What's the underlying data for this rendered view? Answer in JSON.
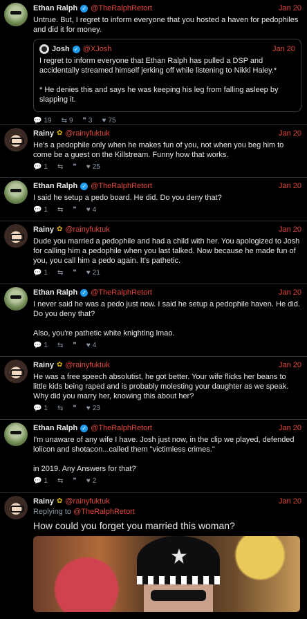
{
  "tweets": [
    {
      "name": "Ethan Ralph",
      "handle": "@TheRalphRetort",
      "date": "Jan 20",
      "text": "Untrue. But, I regret to inform everyone that you hosted a haven for pedophiles and did it for money.",
      "quote": {
        "name": "Josh",
        "handle": "@XJosh",
        "date": "Jan 20",
        "text": "I regret to inform everyone that Ethan Ralph has pulled a DSP and accidentally streamed himself jerking off while listening to Nikki Haley.*\n\n* He denies this and says he was keeping his leg from falling asleep by slapping it."
      },
      "stats": {
        "replies": "19",
        "retweets": "9",
        "quotes": "3",
        "likes": "75"
      }
    },
    {
      "name": "Rainy",
      "handle": "@rainyfuktuk",
      "date": "Jan 20",
      "text": "He's a pedophile only when he makes fun of you, not when you beg him to come be a guest on the Killstream. Funny how that works.",
      "stats": {
        "replies": "1",
        "retweets": "",
        "quotes": "",
        "likes": "25"
      }
    },
    {
      "name": "Ethan Ralph",
      "handle": "@TheRalphRetort",
      "date": "Jan 20",
      "text": "I said he setup a pedo board. He did. Do you deny that?",
      "stats": {
        "replies": "1",
        "retweets": "",
        "quotes": "",
        "likes": "4"
      }
    },
    {
      "name": "Rainy",
      "handle": "@rainyfuktuk",
      "date": "Jan 20",
      "text": "Dude you married a pedophile and had a child with her. You apologized to Josh for calling him a pedophile when you last talked. Now because he made fun of you, you call him a pedo again. It's pathetic.",
      "stats": {
        "replies": "1",
        "retweets": "",
        "quotes": "",
        "likes": "21"
      }
    },
    {
      "name": "Ethan Ralph",
      "handle": "@TheRalphRetort",
      "date": "Jan 20",
      "text": "I never said he was a pedo just now. I said he setup a pedophile haven. He did. Do you deny that?\n\nAlso, you're pathetic white knighting lmao.",
      "stats": {
        "replies": "1",
        "retweets": "",
        "quotes": "",
        "likes": "4"
      }
    },
    {
      "name": "Rainy",
      "handle": "@rainyfuktuk",
      "date": "Jan 20",
      "text": "He was a free speech absolutist, he got better. Your wife flicks her beans to little kids being raped and is probably molesting your daughter as we speak. Why did you marry her, knowing this about her?",
      "stats": {
        "replies": "1",
        "retweets": "",
        "quotes": "",
        "likes": "23"
      }
    },
    {
      "name": "Ethan Ralph",
      "handle": "@TheRalphRetort",
      "date": "Jan 20",
      "text": "I'm unaware of any wife I have. Josh just now, in the clip we played, defended lolicon and shotacon...called them \"victimless crimes.\"\n\nin 2019. Any Answers for that?",
      "stats": {
        "replies": "1",
        "retweets": "",
        "quotes": "",
        "likes": "2"
      }
    },
    {
      "name": "Rainy",
      "handle": "@rainyfuktuk",
      "date": "Jan 20",
      "replying_label": "Replying to",
      "replying_handle": "@TheRalphRetort",
      "text": "How could you forget you married this woman?"
    }
  ]
}
